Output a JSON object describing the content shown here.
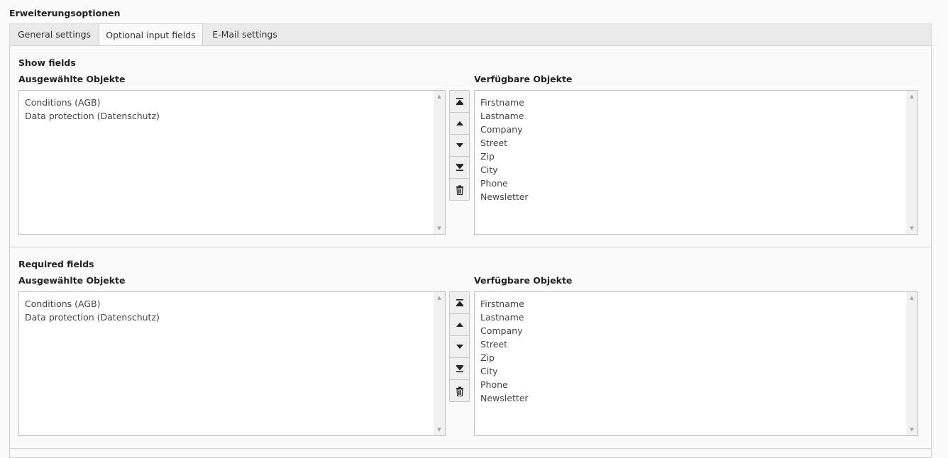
{
  "page_title": "Erweiterungsoptionen",
  "tabs": [
    {
      "label": "General settings",
      "active": false
    },
    {
      "label": "Optional input fields",
      "active": true
    },
    {
      "label": "E-Mail settings",
      "active": false
    }
  ],
  "sections": [
    {
      "title": "Show fields",
      "selected_label": "Ausgewählte Objekte",
      "available_label": "Verfügbare Objekte",
      "selected_items": [
        "Conditions (AGB)",
        "Data protection (Datenschutz)"
      ],
      "available_items": [
        "Firstname",
        "Lastname",
        "Company",
        "Street",
        "Zip",
        "City",
        "Phone",
        "Newsletter"
      ]
    },
    {
      "title": "Required fields",
      "selected_label": "Ausgewählte Objekte",
      "available_label": "Verfügbare Objekte",
      "selected_items": [
        "Conditions (AGB)",
        "Data protection (Datenschutz)"
      ],
      "available_items": [
        "Firstname",
        "Lastname",
        "Company",
        "Street",
        "Zip",
        "City",
        "Phone",
        "Newsletter"
      ]
    }
  ],
  "controls": {
    "buttons": [
      "move-top-icon",
      "move-up-icon",
      "move-down-icon",
      "move-bottom-icon",
      "trash-icon"
    ]
  },
  "colors": {
    "background": "#fafafa",
    "tab_bar": "#eaeaea",
    "border": "#c2c2c2",
    "text": "#333333"
  }
}
